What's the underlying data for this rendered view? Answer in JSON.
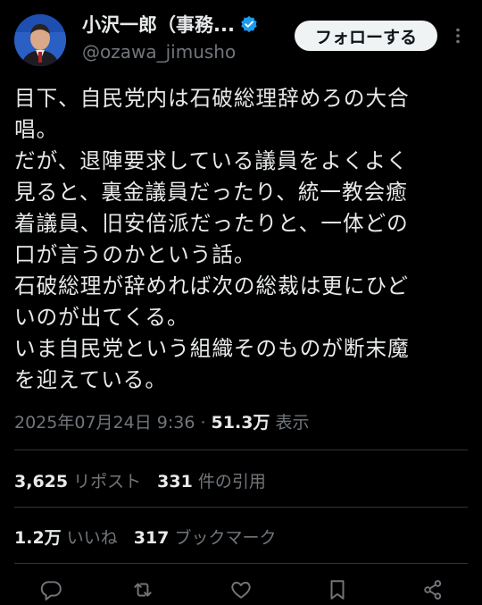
{
  "author": {
    "name": "小沢一郎（事務...",
    "handle": "@ozawa_jimusho"
  },
  "follow_label": "フォローする",
  "tweet": {
    "lines": [
      "目下、自民党内は石破総理辞めろの大合",
      "唱。",
      "だが、退陣要求している議員をよくよく",
      "見ると、裏金議員だったり、統一教会癒",
      "着議員、旧安倍派だったりと、一体どの",
      "口が言うのかという話。",
      "石破総理が辞めれば次の総裁は更にひど",
      "いのが出てくる。",
      "いま自民党という組織そのものが断末魔",
      "を迎えている。"
    ]
  },
  "meta": {
    "datetime": "2025年07月24日 9:36",
    "separator": " · ",
    "views": "51.3万",
    "views_label": " 表示"
  },
  "stats": {
    "reposts": "3,625",
    "reposts_label": "リポスト",
    "quotes": "331",
    "quotes_label": "件の引用",
    "likes": "1.2万",
    "likes_label": "いいね",
    "bookmarks": "317",
    "bookmarks_label": "ブックマーク"
  },
  "icons": {
    "verified": "verified-badge-icon",
    "more": "more-icon",
    "reply": "reply-icon",
    "repost": "repost-icon",
    "like": "like-icon",
    "bookmark": "bookmark-icon",
    "share": "share-icon"
  },
  "colors": {
    "background": "#000000",
    "text": "#e7e9ea",
    "secondary": "#71767b",
    "verified": "#1d9bf0",
    "follow_bg": "#eff3f4"
  }
}
